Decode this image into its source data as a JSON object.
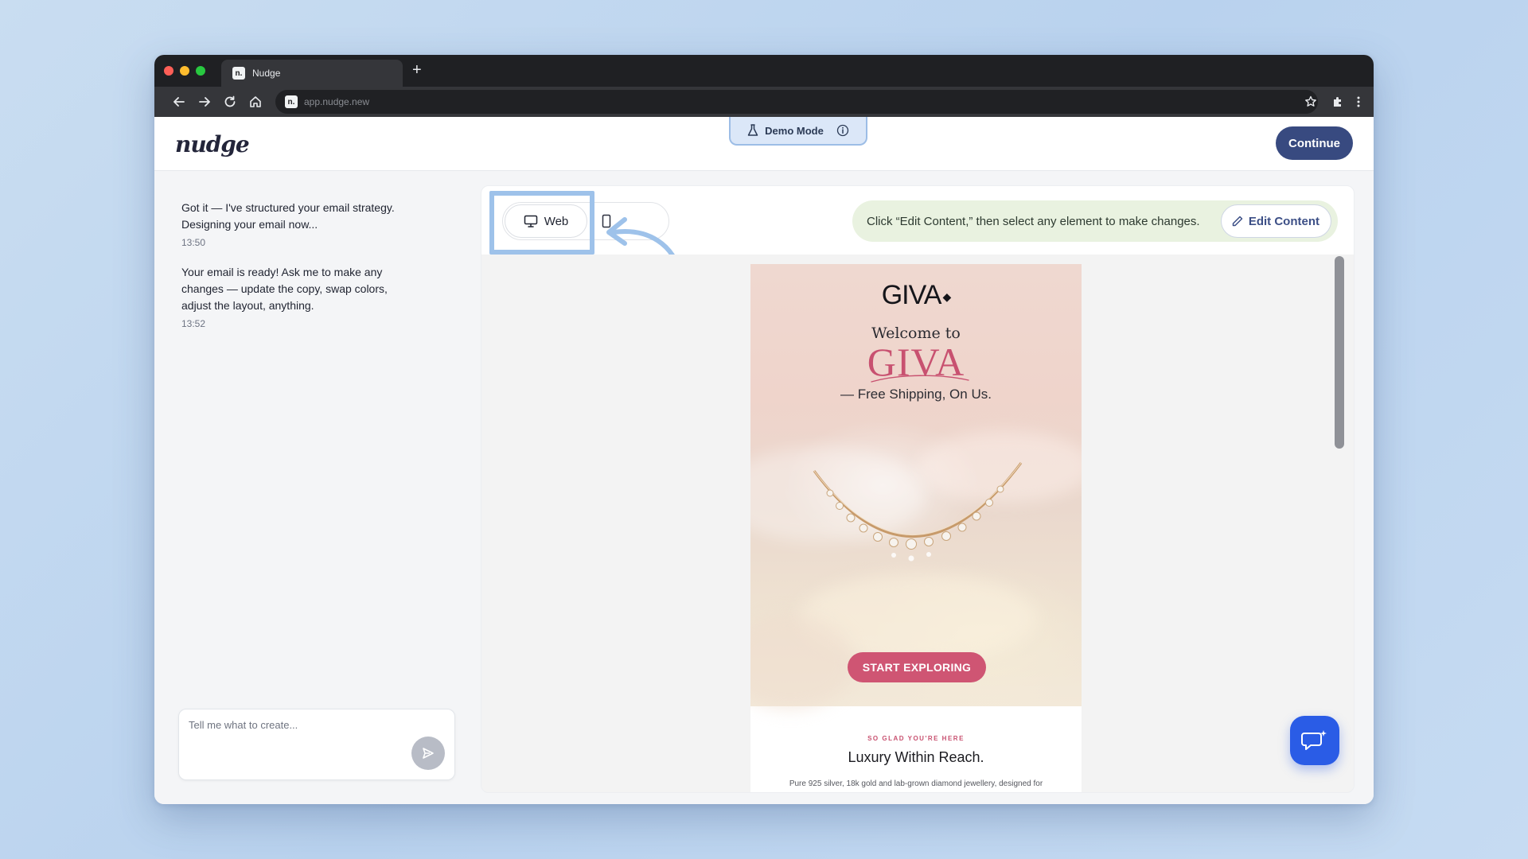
{
  "browser": {
    "tab_title": "Nudge",
    "favicon_text": "n.",
    "new_tab_symbol": "+",
    "url": "app.nudge.new"
  },
  "app": {
    "logo": "nudge",
    "demo_mode_label": "Demo Mode",
    "continue_label": "Continue"
  },
  "chat": {
    "messages": [
      {
        "text": "Got it — I've structured your email strategy. Designing your email now...",
        "time": "13:50"
      },
      {
        "text": "Your email is ready! Ask me to make any changes — update the copy, swap colors, adjust the layout, anything.",
        "time": "13:52"
      }
    ],
    "input_placeholder": "Tell me what to create..."
  },
  "preview": {
    "toggle_web_label": "Web",
    "hint": "Click “Edit Content,” then select any element to make changes.",
    "edit_content_label": "Edit Content"
  },
  "email": {
    "brand_logo": "GIVA",
    "welcome_line": "Welcome to",
    "welcome_brand": "GIVA",
    "tagline": "— Free Shipping, On Us.",
    "cta": "START EXPLORING",
    "kicker": "SO GLAD YOU'RE HERE",
    "headline": "Luxury Within Reach.",
    "body": "Pure 925 silver, 18k gold and lab-grown diamond jewellery, designed for"
  },
  "colors": {
    "accent": "#384a80",
    "brand_pink": "#c85170",
    "fab_blue": "#2a5ce6",
    "highlight": "#9ec2ea"
  }
}
